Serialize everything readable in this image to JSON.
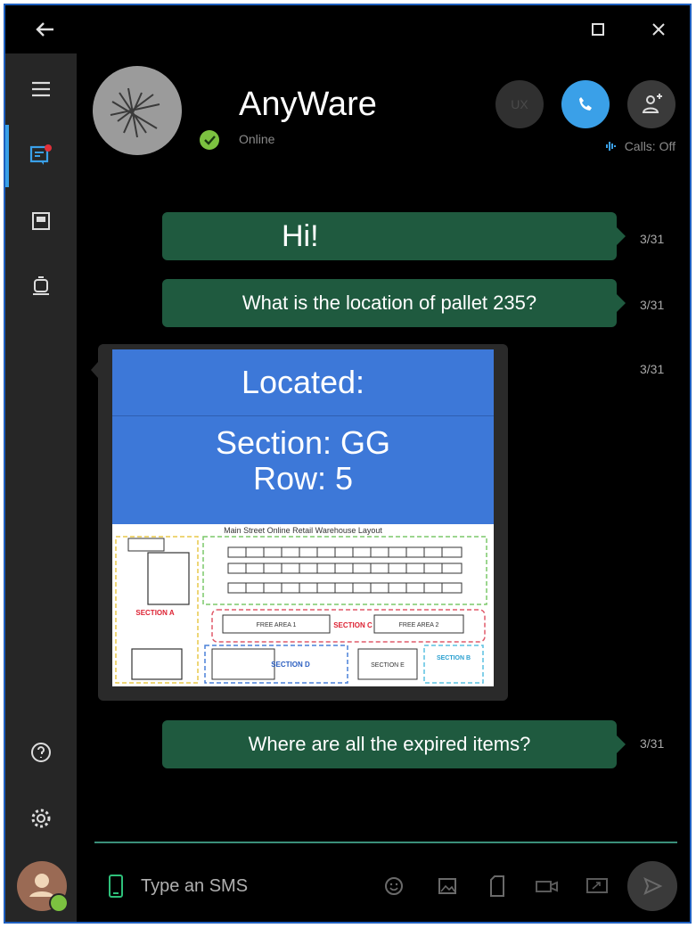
{
  "contact": {
    "name": "AnyWare",
    "status": "Online"
  },
  "header": {
    "calls_status": "Calls: Off",
    "ux_button_label": "UX"
  },
  "messages": [
    {
      "text": "Hi!",
      "time": "3/31"
    },
    {
      "text": "What is the location of pallet 235?",
      "time": "3/31"
    },
    {
      "time": "3/31",
      "card": {
        "title": "Located:",
        "section": "Section: GG",
        "row": "Row: 5"
      }
    },
    {
      "text": "Where are all the expired items?",
      "time": "3/31"
    }
  ],
  "map": {
    "title": "Main Street Online Retail Warehouse Layout",
    "section_a": "SECTION A",
    "section_b": "SECTION B",
    "section_c": "SECTION C",
    "section_d": "SECTION D",
    "section_e": "SECTION E",
    "free_area_1": "FREE AREA 1",
    "free_area_2": "FREE AREA 2"
  },
  "composer": {
    "placeholder": "Type an SMS"
  },
  "colors": {
    "bubble": "#1f5a3f",
    "accent": "#3aa0e8",
    "online": "#7cc240",
    "card_blue": "#3d78d8"
  }
}
